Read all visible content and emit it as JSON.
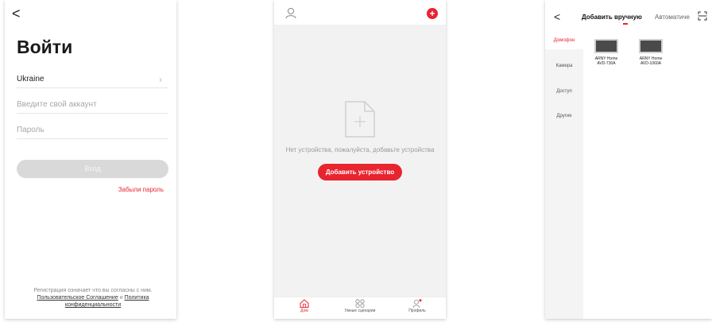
{
  "login": {
    "back": "<",
    "title": "Войти",
    "country": "Ukraine",
    "account_placeholder": "Введите свой аккаунт",
    "password_placeholder": "Пароль",
    "login_label": "Вход",
    "forgot_label": "Забыли пароль",
    "terms_text": "Регистрация означает что вы согласны с ним.",
    "terms_link": "Пользовательское Соглашение",
    "terms_and": "и",
    "privacy_link": "Политика конфиденциальности"
  },
  "home": {
    "empty_text": "Нет устройства, пожалуйста, добавьте устройства",
    "add_device_label": "Добавить устройство",
    "tabs": [
      {
        "label": "Дом",
        "icon": "home-icon"
      },
      {
        "label": "Умные сценарии",
        "icon": "grid-icon"
      },
      {
        "label": "Профиль",
        "icon": "profile-icon"
      }
    ],
    "accent": "#e8242f"
  },
  "add_device": {
    "back": "<",
    "tab_manual": "Добавить вручную",
    "tab_auto": "Автоматиче",
    "categories": [
      "Домофон",
      "Камера",
      "Доступ",
      "Другие"
    ],
    "devices": [
      {
        "name_line1": "ARNY Home",
        "name_line2": "AVD-730A"
      },
      {
        "name_line1": "ARNY Home",
        "name_line2": "AVD-1060A"
      }
    ]
  }
}
